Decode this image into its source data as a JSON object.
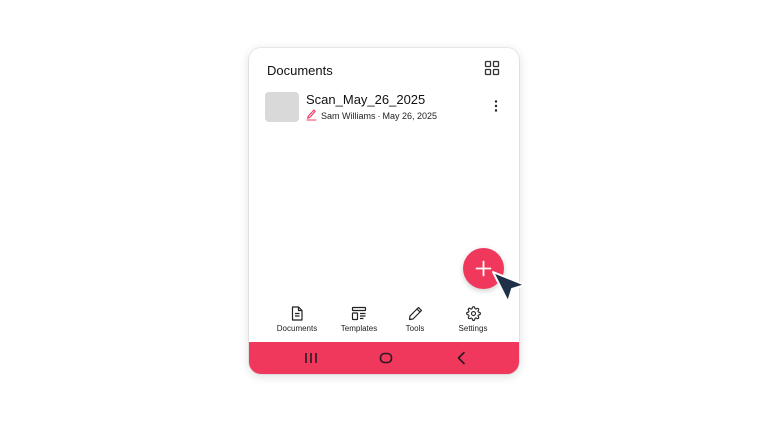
{
  "header": {
    "title": "Documents",
    "grid_icon": "grid-view-icon"
  },
  "documents": [
    {
      "name": "Scan_May_26_2025",
      "author": "Sam Williams",
      "separator": "·",
      "date": "May 26, 2025",
      "status_icon": "signature-icon"
    }
  ],
  "fab": {
    "icon": "plus-icon"
  },
  "tabs": [
    {
      "label": "Documents",
      "icon": "document-icon"
    },
    {
      "label": "Templates",
      "icon": "templates-icon"
    },
    {
      "label": "Tools",
      "icon": "pencil-icon"
    },
    {
      "label": "Settings",
      "icon": "gear-icon"
    }
  ],
  "nav": {
    "recents_icon": "recents-icon",
    "home_icon": "home-icon",
    "back_icon": "back-icon"
  },
  "colors": {
    "accent": "#f0385d",
    "thumbnail": "#d9d9d9",
    "cursor": "#1e3148"
  }
}
